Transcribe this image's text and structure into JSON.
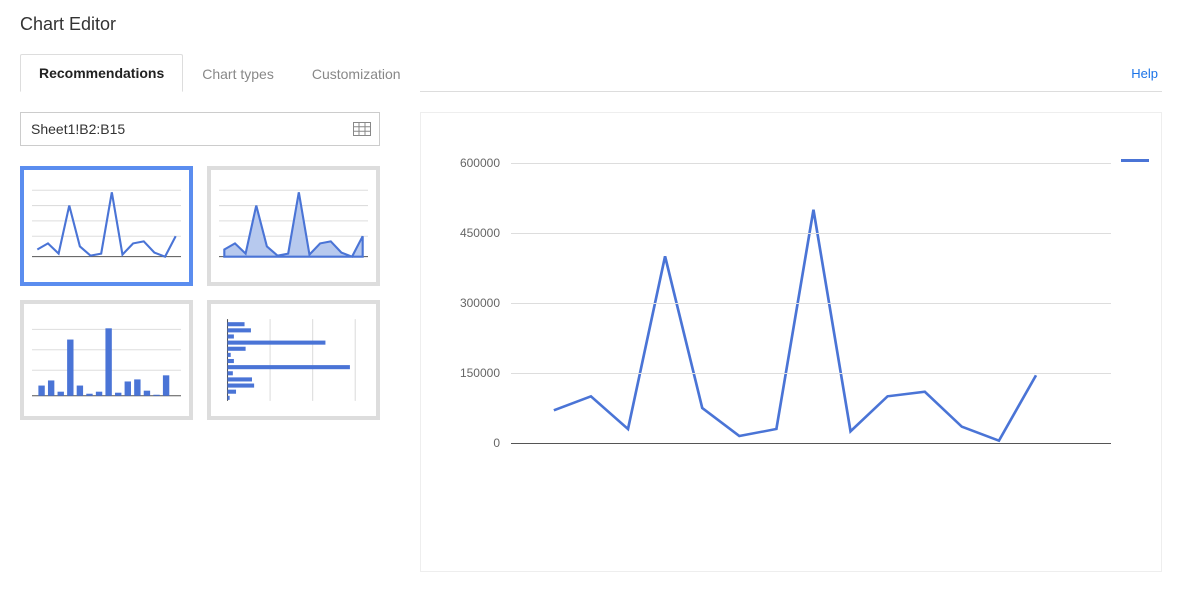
{
  "header": {
    "title": "Chart Editor"
  },
  "tabs": {
    "recommendations": "Recommendations",
    "chart_types": "Chart types",
    "customization": "Customization"
  },
  "help_label": "Help",
  "range": {
    "value": "Sheet1!B2:B15"
  },
  "colors": {
    "accent": "#4a74d6"
  },
  "chart_data": {
    "type": "line",
    "ylim": [
      0,
      600000
    ],
    "yticks": [
      0,
      150000,
      300000,
      450000,
      600000
    ],
    "ytick_labels": [
      "0",
      "150000",
      "300000",
      "450000",
      "600000"
    ],
    "x_indices": [
      1,
      2,
      3,
      4,
      5,
      6,
      7,
      8,
      9,
      10,
      11,
      12,
      13,
      14
    ],
    "values": [
      70000,
      100000,
      30000,
      400000,
      75000,
      15000,
      30000,
      500000,
      25000,
      100000,
      110000,
      35000,
      5000,
      145000
    ]
  }
}
